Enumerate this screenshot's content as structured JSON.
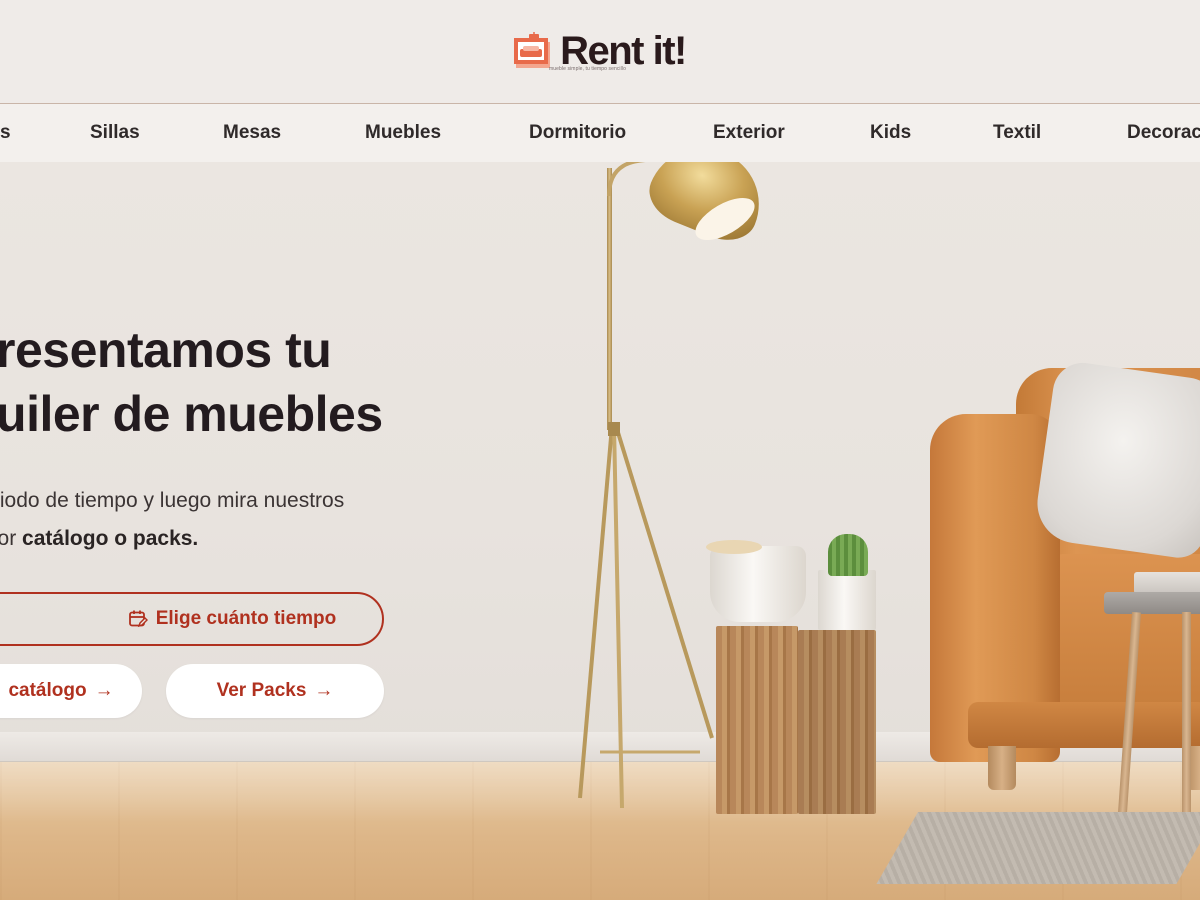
{
  "header": {
    "logo_text": "Rent it!",
    "logo_tagline": "mueble simple, tu tiempo sencillo",
    "logo_icon": "logo-sofa-icon",
    "brand_color": "#e86a4a"
  },
  "nav": {
    "items": [
      "s",
      "Sillas",
      "Mesas",
      "Muebles",
      "Dormitorio",
      "Exterior",
      "Kids",
      "Textil",
      "Decorac"
    ]
  },
  "hero": {
    "title_line1": "presentamos tu",
    "title_line2": "quiler de muebles",
    "subtitle_line1": "n periodo de tiempo y luego mira nuestros",
    "subtitle_line2_prefix": "tos por ",
    "subtitle_line2_bold": "catálogo o packs.",
    "primary_button": "Elige cuánto tiempo",
    "primary_button_icon": "calendar-edit-icon",
    "catalog_button": "catálogo",
    "packs_button": "Ver Packs",
    "button_arrow": "→",
    "accent_color": "#b0311f"
  }
}
